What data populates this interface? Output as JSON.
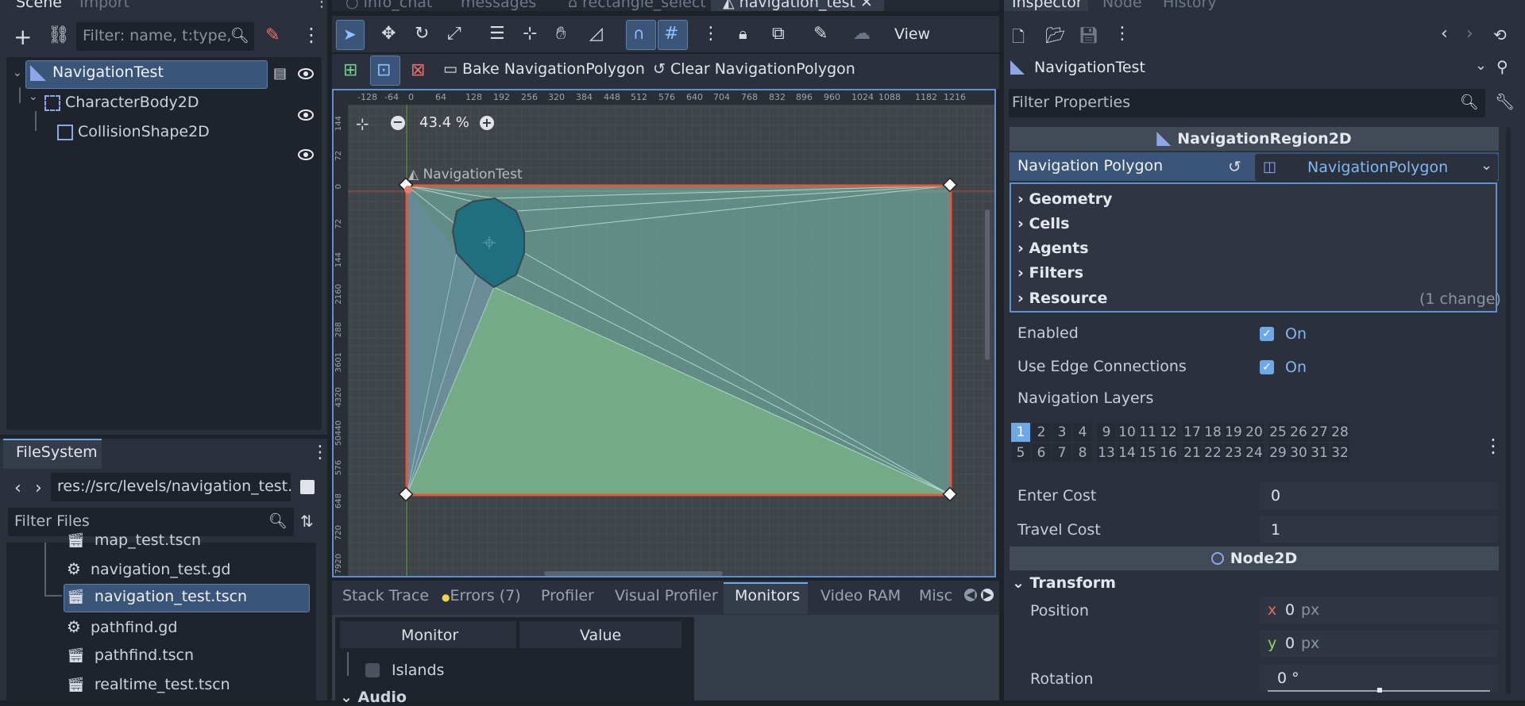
{
  "left": {
    "tabs": [
      "Scene",
      "Import"
    ],
    "filter_placeholder": "Filter: name, t:type, g",
    "tree": [
      {
        "label": "NavigationTest"
      },
      {
        "label": "CharacterBody2D"
      },
      {
        "label": "CollisionShape2D"
      }
    ]
  },
  "filesystem": {
    "tab": "FileSystem",
    "path": "res://src/levels/navigation_test.ts",
    "filter_placeholder": "Filter Files",
    "files": [
      {
        "name": "map_test.tscn",
        "type": "scene"
      },
      {
        "name": "navigation_test.gd",
        "type": "script"
      },
      {
        "name": "navigation_test.tscn",
        "type": "scene"
      },
      {
        "name": "pathfind.gd",
        "type": "script"
      },
      {
        "name": "pathfind.tscn",
        "type": "scene"
      },
      {
        "name": "realtime_test.tscn",
        "type": "scene"
      }
    ]
  },
  "editor_tabs": [
    {
      "label": "info_chat"
    },
    {
      "label": "messages"
    },
    {
      "label": "rectangle_select"
    },
    {
      "label": "navigation_test"
    }
  ],
  "toolbar": {
    "view_label": "View",
    "bake_label": "Bake NavigationPolygon",
    "clear_label": "Clear NavigationPolygon"
  },
  "viewport": {
    "zoom": "43.4 %",
    "node_label": "NavigationTest",
    "ruler_top": [
      "-128",
      "-64",
      "0",
      "64",
      "128",
      "192",
      "256",
      "320",
      "384",
      "448",
      "512",
      "576",
      "640",
      "704",
      "768",
      "832",
      "896",
      "960",
      "1024",
      "1088",
      "1182",
      "1216"
    ],
    "ruler_left": [
      "144",
      "72",
      "0",
      "72",
      "144",
      "2160",
      "288",
      "3601",
      "4320",
      "50440",
      "576",
      "648",
      "720",
      "7920"
    ]
  },
  "bottom": {
    "tabs": [
      "Stack Trace",
      "Errors (7)",
      "Profiler",
      "Visual Profiler",
      "Monitors",
      "Video RAM",
      "Misc"
    ],
    "monitor_header": "Monitor",
    "value_header": "Value",
    "rows": [
      "Islands",
      "Audio"
    ]
  },
  "inspector": {
    "tabs": [
      "Inspector",
      "Node",
      "History"
    ],
    "object": "NavigationTest",
    "filter_placeholder": "Filter Properties",
    "class_header": "NavigationRegion2D",
    "nav_poly_label": "Navigation Polygon",
    "nav_poly_value": "NavigationPolygon",
    "sub_sections": [
      {
        "label": "Geometry"
      },
      {
        "label": "Cells"
      },
      {
        "label": "Agents"
      },
      {
        "label": "Filters"
      },
      {
        "label": "Resource",
        "note": "(1 change)"
      }
    ],
    "enabled_label": "Enabled",
    "enabled_value": "On",
    "edge_label": "Use Edge Connections",
    "edge_value": "On",
    "layers_label": "Navigation Layers",
    "layers_row1": [
      "1",
      "2",
      "3",
      "4",
      "9",
      "10",
      "11",
      "12",
      "17",
      "18",
      "19",
      "20",
      "25",
      "26",
      "27",
      "28"
    ],
    "layers_row2": [
      "5",
      "6",
      "7",
      "8",
      "13",
      "14",
      "15",
      "16",
      "21",
      "22",
      "23",
      "24",
      "29",
      "30",
      "31",
      "32"
    ],
    "enter_cost_label": "Enter Cost",
    "enter_cost_value": "0",
    "travel_cost_label": "Travel Cost",
    "travel_cost_value": "1",
    "node2d_header": "Node2D",
    "transform_label": "Transform",
    "position_label": "Position",
    "pos_x_axis": "x",
    "pos_x": "0",
    "pos_y_axis": "y",
    "pos_y": "0",
    "unit_px": "px",
    "rotation_label": "Rotation",
    "rotation_value": "0 °"
  },
  "colors": {
    "accent": "#6ea8e8",
    "selection": "#3b5578",
    "panel": "#363d4a",
    "background": "#1d2229",
    "nav_border": "#e8553a",
    "nav_fill": "#7fc6b4"
  }
}
